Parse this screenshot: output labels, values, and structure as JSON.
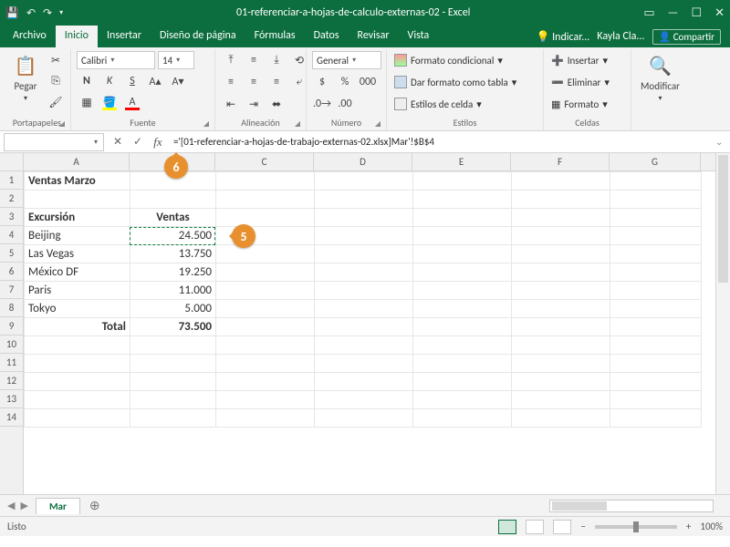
{
  "title": "01-referenciar-a-hojas-de-calculo-externas-02 - Excel",
  "menu": {
    "archivo": "Archivo",
    "inicio": "Inicio",
    "insertar": "Insertar",
    "diseno": "Diseño de página",
    "formulas": "Fórmulas",
    "datos": "Datos",
    "revisar": "Revisar",
    "vista": "Vista",
    "tell": "Indicar...",
    "user": "Kayla Cla...",
    "share": "Compartir"
  },
  "ribbon": {
    "clipboard": {
      "paste": "Pegar",
      "label": "Portapapeles"
    },
    "font": {
      "name": "Calibri",
      "size": "14",
      "bold": "N",
      "italic": "K",
      "underline": "S",
      "label": "Fuente"
    },
    "align": {
      "label": "Alineación"
    },
    "number": {
      "format": "General",
      "label": "Número"
    },
    "styles": {
      "cond": "Formato condicional",
      "table": "Dar formato como tabla",
      "cell": "Estilos de celda",
      "label": "Estilos"
    },
    "cells": {
      "insert": "Insertar",
      "delete": "Eliminar",
      "format": "Formato",
      "label": "Celdas"
    },
    "editing": {
      "label": "Modificar"
    }
  },
  "formulabar": {
    "name": "",
    "formula": "='[01-referenciar-a-hojas-de-trabajo-externas-02.xlsx]Mar'!$B$4"
  },
  "cols": [
    "A",
    "B",
    "C",
    "D",
    "E",
    "F",
    "G"
  ],
  "rows": [
    "1",
    "2",
    "3",
    "4",
    "5",
    "6",
    "7",
    "8",
    "9",
    "10",
    "11",
    "12",
    "13",
    "14"
  ],
  "sheet": {
    "a1": "Ventas Marzo",
    "a3": "Excursión",
    "b3": "Ventas",
    "a4": "Beijing",
    "b4": "24.500",
    "a5": "Las Vegas",
    "b5": "13.750",
    "a6": "México DF",
    "b6": "19.250",
    "a7": "Paris",
    "b7": "11.000",
    "a8": "Tokyo",
    "b8": "5.000",
    "a9": "Total",
    "b9": "73.500"
  },
  "tabs": {
    "mar": "Mar"
  },
  "status": {
    "ready": "Listo",
    "zoom": "100%"
  },
  "callouts": {
    "c5": "5",
    "c6": "6"
  }
}
